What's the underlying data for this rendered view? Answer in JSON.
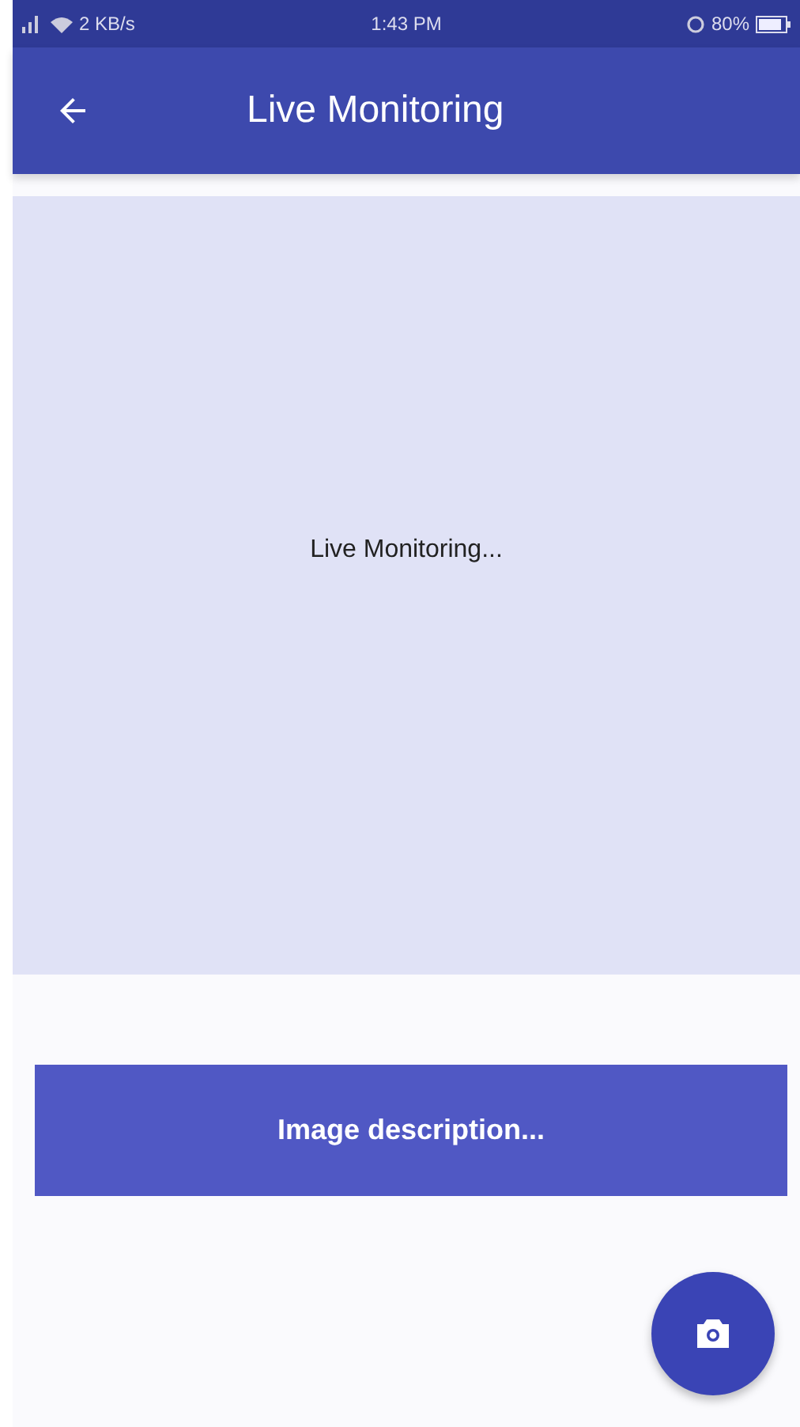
{
  "status_bar": {
    "network_speed": "2 KB/s",
    "time": "1:43 PM",
    "battery": "80%"
  },
  "app_bar": {
    "title": "Live Monitoring"
  },
  "monitor": {
    "message": "Live Monitoring..."
  },
  "description_button": {
    "label": "Image description..."
  }
}
